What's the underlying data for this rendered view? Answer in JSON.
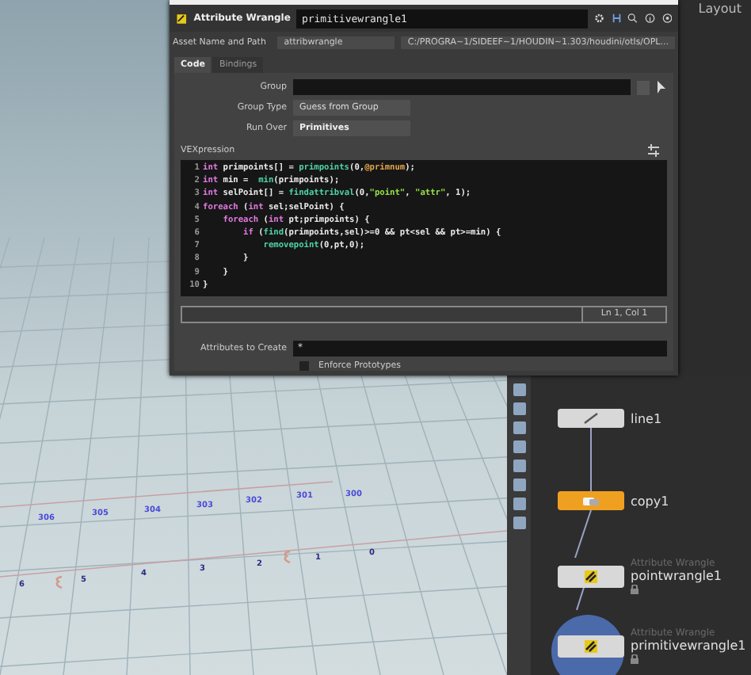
{
  "top_menu": [
    {
      "label": "Layout"
    }
  ],
  "viewport": {
    "point_labels": [
      {
        "text": "306",
        "kind": "prim"
      },
      {
        "text": "305",
        "kind": "prim"
      },
      {
        "text": "304",
        "kind": "prim"
      },
      {
        "text": "303",
        "kind": "prim"
      },
      {
        "text": "302",
        "kind": "prim"
      },
      {
        "text": "301",
        "kind": "prim"
      },
      {
        "text": "300",
        "kind": "prim"
      },
      {
        "text": "6",
        "kind": "point"
      },
      {
        "text": "5",
        "kind": "point"
      },
      {
        "text": "4",
        "kind": "point"
      },
      {
        "text": "3",
        "kind": "point"
      },
      {
        "text": "2",
        "kind": "point"
      },
      {
        "text": "1",
        "kind": "point"
      },
      {
        "text": "0",
        "kind": "point"
      }
    ]
  },
  "parameter_editor": {
    "node_type": "Attribute Wrangle",
    "node_name": "primitivewrangle1",
    "asset_label": "Asset Name and Path",
    "asset_name": "attribwrangle",
    "asset_path": "C:/PROGRA~1/SIDEEF~1/HOUDIN~1.303/houdini/otls/OPL...",
    "tabs": [
      {
        "label": "Code",
        "selected": true
      },
      {
        "label": "Bindings",
        "selected": false
      }
    ],
    "params": [
      {
        "label": "Group",
        "kind": "text"
      },
      {
        "label": "Group Type",
        "kind": "menu",
        "value": "Guess from Group"
      },
      {
        "label": "Run Over",
        "kind": "menu",
        "value": "Primitives"
      }
    ],
    "vex_label": "VEXpression",
    "code_lines": [
      {
        "number": "1",
        "tokens": [
          {
            "kind": "kw",
            "text": "int"
          },
          {
            "kind": "plain",
            "text": " primpoints[] = "
          },
          {
            "kind": "fn",
            "text": "primpoints"
          },
          {
            "kind": "plain",
            "text": "(0,"
          },
          {
            "kind": "attr",
            "text": "@primnum"
          },
          {
            "kind": "plain",
            "text": ");"
          }
        ]
      },
      {
        "number": "2",
        "tokens": [
          {
            "kind": "kw",
            "text": "int"
          },
          {
            "kind": "plain",
            "text": " min =  "
          },
          {
            "kind": "fn",
            "text": "min"
          },
          {
            "kind": "plain",
            "text": "(primpoints);"
          }
        ]
      },
      {
        "number": "3",
        "tokens": [
          {
            "kind": "kw",
            "text": "int"
          },
          {
            "kind": "plain",
            "text": " selPoint[] = "
          },
          {
            "kind": "fn",
            "text": "findattribval"
          },
          {
            "kind": "plain",
            "text": "(0,"
          },
          {
            "kind": "str",
            "text": "\"point\""
          },
          {
            "kind": "plain",
            "text": ", "
          },
          {
            "kind": "str",
            "text": "\"attr\""
          },
          {
            "kind": "plain",
            "text": ", 1);"
          }
        ]
      },
      {
        "number": "4",
        "tokens": [
          {
            "kind": "kw",
            "text": "foreach"
          },
          {
            "kind": "plain",
            "text": " ("
          },
          {
            "kind": "kw",
            "text": "int"
          },
          {
            "kind": "plain",
            "text": " sel;selPoint) {"
          }
        ]
      },
      {
        "number": "5",
        "tokens": [
          {
            "kind": "kw",
            "text": "    foreach"
          },
          {
            "kind": "plain",
            "text": " ("
          },
          {
            "kind": "kw",
            "text": "int"
          },
          {
            "kind": "plain",
            "text": " pt;primpoints) {"
          }
        ]
      },
      {
        "number": "6",
        "tokens": [
          {
            "kind": "kw",
            "text": "        if"
          },
          {
            "kind": "plain",
            "text": " ("
          },
          {
            "kind": "fn",
            "text": "find"
          },
          {
            "kind": "plain",
            "text": "(primpoints,sel)>=0 && pt<sel && pt>=min) {"
          }
        ]
      },
      {
        "number": "7",
        "tokens": [
          {
            "kind": "fn",
            "text": "            removepoint"
          },
          {
            "kind": "plain",
            "text": "(0,pt,0);"
          }
        ]
      },
      {
        "number": "8",
        "tokens": [
          {
            "kind": "plain",
            "text": "        }"
          }
        ]
      },
      {
        "number": "9",
        "tokens": [
          {
            "kind": "plain",
            "text": "    }"
          }
        ]
      },
      {
        "number": "10",
        "tokens": [
          {
            "kind": "plain",
            "text": "}"
          }
        ]
      }
    ],
    "cursor_position": "Ln 1, Col 1",
    "attributes_label": "Attributes to Create",
    "attributes_value": "*",
    "enforce": {
      "label": "Enforce Prototypes",
      "checked": false
    }
  },
  "network": {
    "nodes": [
      {
        "name": "line1",
        "kind": "line",
        "color": "#d8d8d8"
      },
      {
        "name": "copy1",
        "kind": "copy",
        "color": "#f0a020"
      },
      {
        "type_label": "Attribute Wrangle",
        "name": "pointwrangle1",
        "kind": "wrangle",
        "color": "#d8d8d8",
        "locked": true
      },
      {
        "type_label": "Attribute Wrangle",
        "name": "primitivewrangle1",
        "kind": "wrangle",
        "color": "#d8d8d8",
        "display": true,
        "locked": true
      }
    ]
  }
}
